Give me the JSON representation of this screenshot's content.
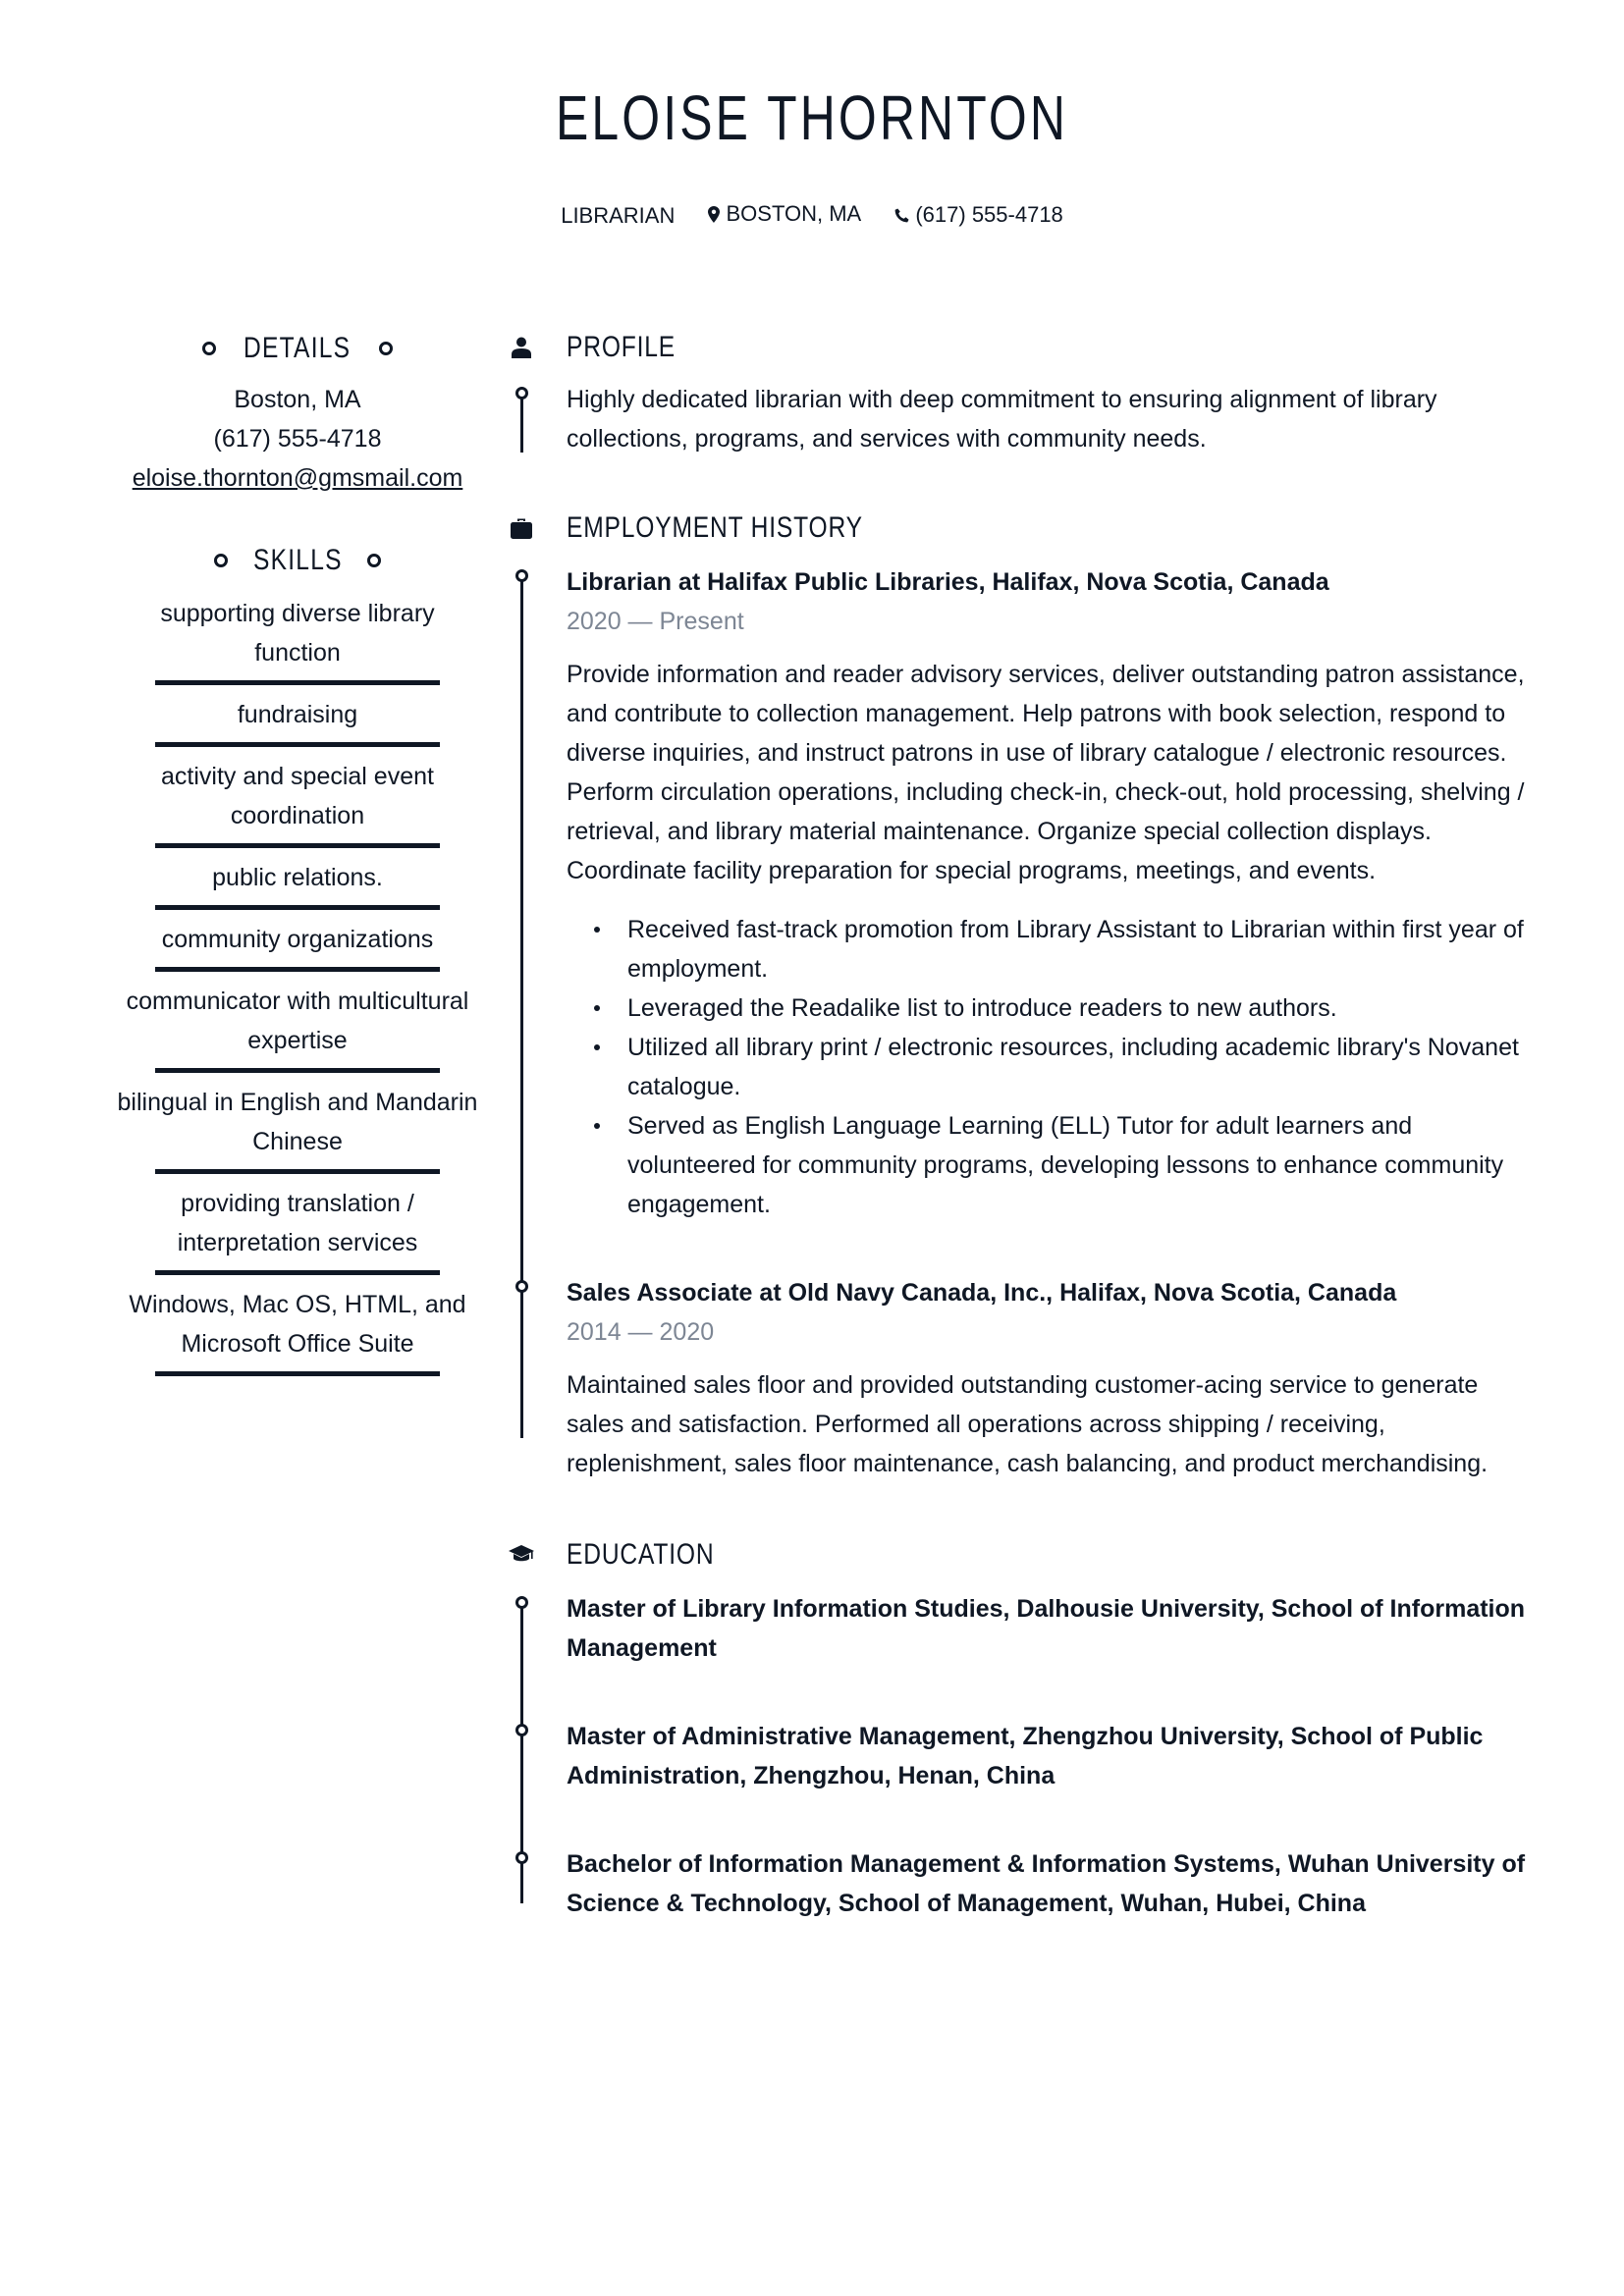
{
  "header": {
    "name": "ELOISE THORNTON",
    "job_title": "LIBRARIAN",
    "location": "BOSTON, MA",
    "phone": "(617) 555-4718",
    "location_icon": "map-pin-icon",
    "phone_icon": "phone-icon"
  },
  "details": {
    "heading": "DETAILS",
    "city": "Boston, MA",
    "phone": "(617) 555-4718",
    "email": "eloise.thornton@gmsmail.com"
  },
  "skills": {
    "heading": "SKILLS",
    "items": [
      "supporting diverse library function",
      "fundraising",
      "activity and special event coordination",
      "public relations.",
      "community organizations",
      "communicator with multicultural expertise",
      "bilingual in English and Mandarin Chinese",
      "providing translation / interpretation services",
      "Windows, Mac OS, HTML, and Microsoft Office Suite"
    ]
  },
  "profile": {
    "heading": "PROFILE",
    "icon": "person-icon",
    "text": "Highly dedicated librarian with deep commitment to ensuring alignment of library collections, programs, and services with community needs."
  },
  "employment": {
    "heading": "EMPLOYMENT HISTORY",
    "icon": "briefcase-icon",
    "jobs": [
      {
        "title": "Librarian at Halifax Public Libraries, Halifax, Nova Scotia, Canada",
        "dates": "2020 — Present",
        "description": "Provide information and reader advisory services, deliver outstanding patron assistance, and contribute to collection management. Help patrons with book selection, respond to diverse inquiries, and instruct patrons in use of library catalogue / electronic resources. Perform circulation operations, including check-in, check-out, hold processing, shelving / retrieval, and library material maintenance. Organize special collection displays. Coordinate facility preparation for special programs, meetings, and events.",
        "bullets": [
          "Received fast-track promotion from Library Assistant to Librarian within first year of employment.",
          "Leveraged the Readalike list to introduce readers to new authors.",
          "Utilized all library print / electronic resources, including academic library's Novanet catalogue.",
          "Served as English Language Learning (ELL) Tutor for adult learners and volunteered for community programs, developing lessons to enhance community engagement."
        ]
      },
      {
        "title": "Sales Associate at Old Navy Canada, Inc., Halifax, Nova Scotia, Canada",
        "dates": "2014 — 2020",
        "description": "Maintained sales floor and provided outstanding customer-acing service to generate sales and satisfaction. Performed all operations across shipping / receiving, replenishment, sales floor maintenance, cash balancing, and product merchandising."
      }
    ]
  },
  "education": {
    "heading": "EDUCATION",
    "icon": "graduation-cap-icon",
    "items": [
      "Master of Library Information Studies, Dalhousie University, School of Information Management",
      "Master of Administrative Management, Zhengzhou University, School of Public Administration, Zhengzhou, Henan, China",
      "Bachelor of Information Management & Information Systems, Wuhan University of Science & Technology, School of Management, Wuhan, Hubei, China"
    ]
  }
}
